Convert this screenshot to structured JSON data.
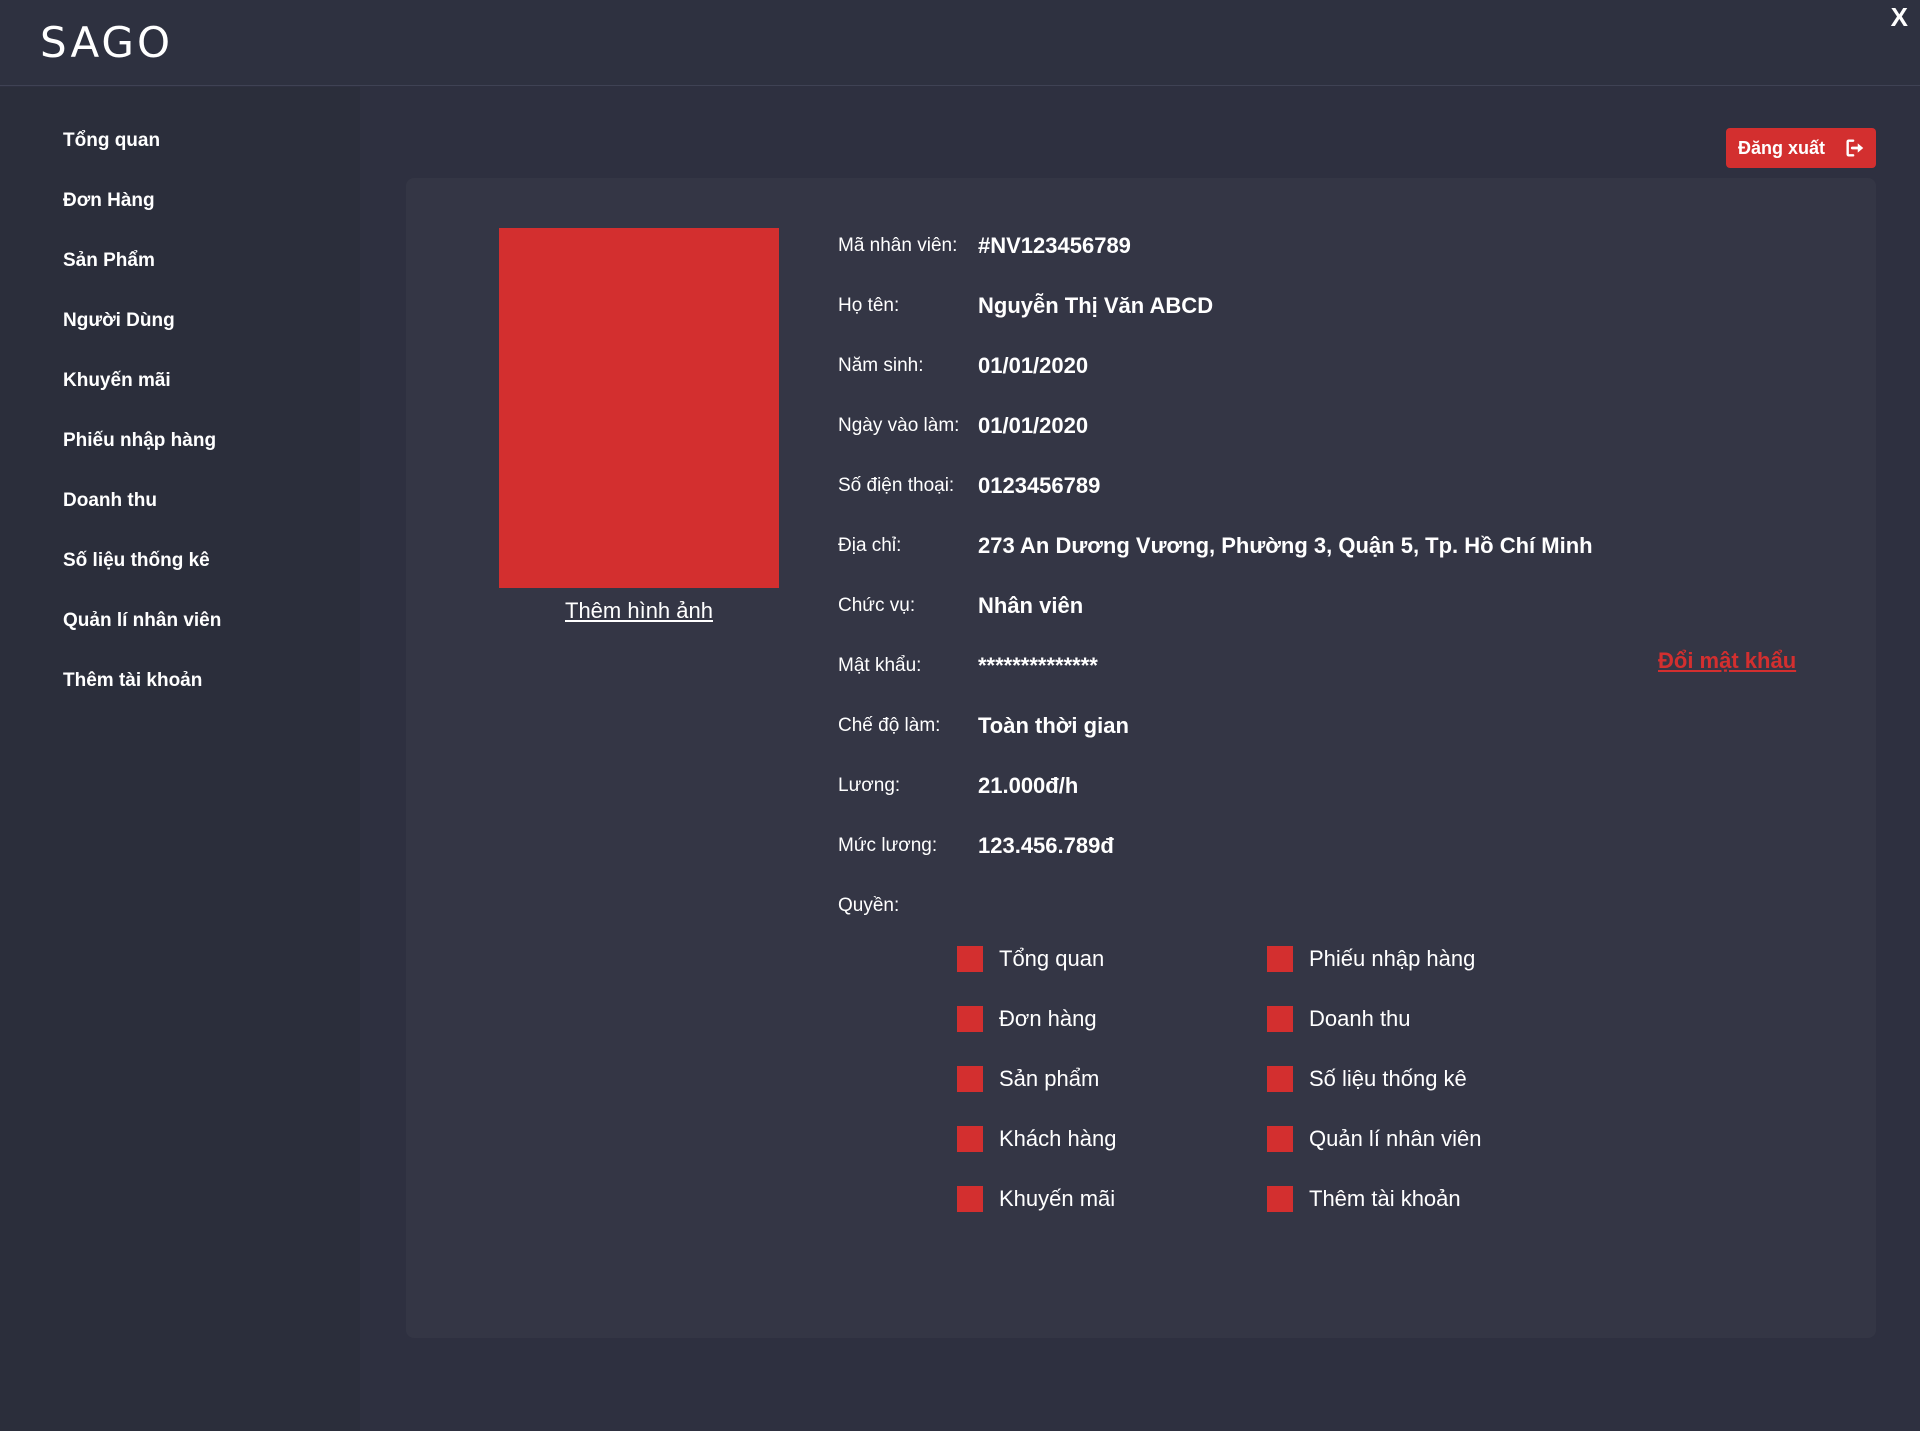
{
  "app": {
    "logo": "SAGO",
    "close_label": "X"
  },
  "sidebar": {
    "items": [
      {
        "label": "Tổng quan"
      },
      {
        "label": "Đơn Hàng"
      },
      {
        "label": "Sản Phẩm"
      },
      {
        "label": "Người Dùng"
      },
      {
        "label": "Khuyến mãi"
      },
      {
        "label": "Phiếu nhập hàng"
      },
      {
        "label": "Doanh thu"
      },
      {
        "label": "Số liệu thống kê"
      },
      {
        "label": "Quản lí nhân viên"
      },
      {
        "label": "Thêm tài khoản"
      }
    ]
  },
  "header": {
    "logout_label": "Đăng xuất",
    "logout_icon": "sign-out-icon"
  },
  "profile": {
    "photo_link": "Thêm hình ảnh",
    "fields": [
      {
        "label": "Mã nhân viên:",
        "value": "#NV123456789"
      },
      {
        "label": "Họ tên:",
        "value": "Nguyễn Thị Văn ABCD"
      },
      {
        "label": "Năm sinh:",
        "value": "01/01/2020"
      },
      {
        "label": "Ngày vào làm:",
        "value": "01/01/2020"
      },
      {
        "label": "Số điện thoại:",
        "value": "0123456789"
      },
      {
        "label": "Địa chỉ:",
        "value": "273 An Dương Vương, Phường 3, Quận 5, Tp. Hồ Chí Minh"
      },
      {
        "label": "Chức vụ:",
        "value": "Nhân viên"
      },
      {
        "label": "Mật khẩu:",
        "value": "**************"
      },
      {
        "label": "Chế độ làm:",
        "value": "Toàn thời gian"
      },
      {
        "label": "Lương:",
        "value": "21.000đ/h"
      },
      {
        "label": "Mức lương:",
        "value": "123.456.789đ"
      }
    ],
    "change_password": "Đổi mật khẩu",
    "permissions_label": "Quyền:",
    "permissions_left": [
      "Tổng quan",
      "Đơn hàng",
      "Sản phẩm",
      "Khách hàng",
      "Khuyến mãi"
    ],
    "permissions_right": [
      "Phiếu nhập hàng",
      "Doanh thu",
      "Số liệu thống kê",
      "Quản lí nhân viên",
      "Thêm tài khoản"
    ]
  },
  "colors": {
    "accent": "#d32f2f",
    "background": "#2e3040",
    "panel": "#343645",
    "sidebar": "#2b2e3b"
  }
}
